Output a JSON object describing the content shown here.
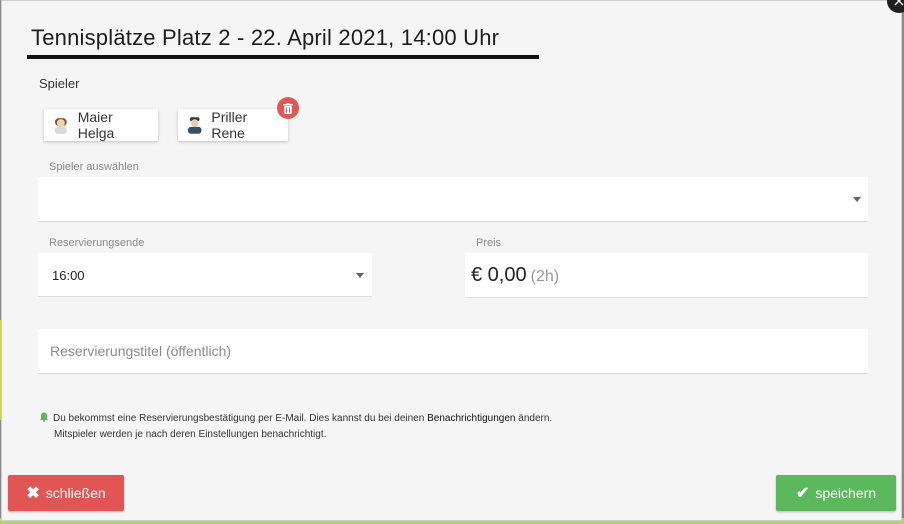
{
  "dialog": {
    "title": "Tennisplätze Platz 2 - 22. April 2021, 14:00 Uhr",
    "close_icon": "×"
  },
  "players": {
    "section_label": "Spieler",
    "items": [
      {
        "name": "Maier Helga",
        "avatar_icon": "female-avatar-icon"
      },
      {
        "name": "Priller Rene",
        "avatar_icon": "male-avatar-icon"
      }
    ],
    "delete_icon": "trash-icon",
    "accent_delete": "#e25656"
  },
  "player_select": {
    "label": "Spieler auswählen",
    "value": ""
  },
  "reservation_end": {
    "label": "Reservierungsende",
    "value": "16:00"
  },
  "price": {
    "label": "Preis",
    "value": "€ 0,00",
    "duration": "(2h)"
  },
  "reservation_title": {
    "placeholder": "Reservierungstitel (öffentlich)"
  },
  "info": {
    "line1_prefix": "Du bekommst eine Reservierungsbestätigung per E-Mail. Dies kannst du bei deinen",
    "link": "Benachrichtigungen",
    "line1_suffix": "ändern.",
    "line2": "Mitspieler werden je nach deren Einstellungen benachrichtigt.",
    "bell_color": "#5cb85c"
  },
  "buttons": {
    "close_label": "schließen",
    "save_label": "speichern",
    "close_color": "#e25555",
    "save_color": "#5cb85c"
  }
}
